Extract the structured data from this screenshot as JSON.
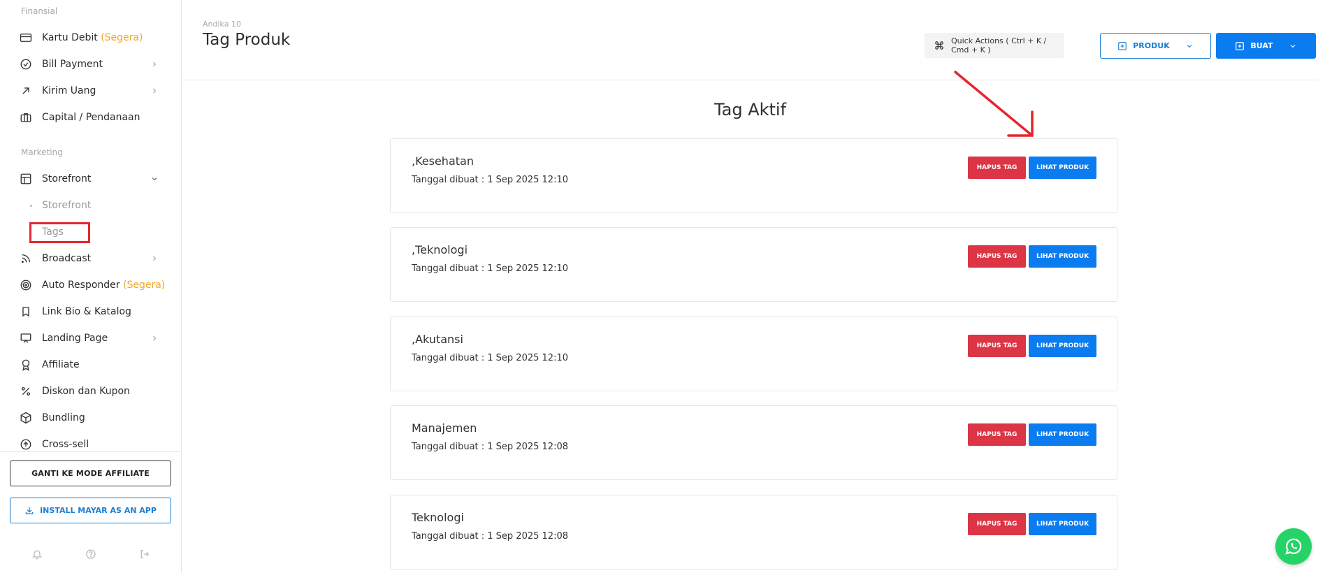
{
  "sidebar": {
    "section_finansial": "Finansial",
    "kartu_debit": "Kartu Debit ",
    "kartu_debit_soon": "(Segera)",
    "bill_payment": "Bill Payment",
    "kirim_uang": "Kirim Uang",
    "capital": "Capital / Pendanaan",
    "section_marketing": "Marketing",
    "storefront": "Storefront",
    "sub_storefront": "Storefront",
    "sub_tags": "Tags",
    "broadcast": "Broadcast",
    "auto_responder": "Auto Responder ",
    "auto_responder_soon": "(Segera)",
    "link_bio": "Link Bio & Katalog",
    "landing_page": "Landing Page",
    "affiliate": "Affiliate",
    "diskon": "Diskon dan Kupon",
    "bundling": "Bundling",
    "cross_sell": "Cross-sell",
    "btn_affiliate_mode": "GANTI KE MODE AFFILIATE",
    "btn_install": "INSTALL MAYAR AS AN APP"
  },
  "header": {
    "breadcrumb": "Andika 10",
    "title": "Tag Produk",
    "quick_actions": "Quick Actions ( Ctrl + K / Cmd + K )",
    "btn_produk": "PRODUK",
    "btn_buat": "BUAT"
  },
  "main": {
    "title": "Tag Aktif",
    "btn_hapus": "HAPUS TAG",
    "btn_lihat": "LIHAT PRODUK",
    "tags": [
      {
        "name": ",Kesehatan",
        "date": "Tanggal dibuat : 1 Sep 2025 12:10"
      },
      {
        "name": ",Teknologi",
        "date": "Tanggal dibuat : 1 Sep 2025 12:10"
      },
      {
        "name": ",Akutansi",
        "date": "Tanggal dibuat : 1 Sep 2025 12:10"
      },
      {
        "name": "Manajemen",
        "date": "Tanggal dibuat : 1 Sep 2025 12:08"
      },
      {
        "name": "Teknologi",
        "date": "Tanggal dibuat : 1 Sep 2025 12:08"
      }
    ]
  },
  "colors": {
    "primary": "#0a7cf0",
    "danger": "#dc3545",
    "soon": "#f5a623",
    "annotation": "#e5262d",
    "whatsapp": "#25d366"
  },
  "icons": [
    "credit-card-icon",
    "check-circle-icon",
    "arrow-up-right-icon",
    "briefcase-icon",
    "layout-icon",
    "rss-icon",
    "target-icon",
    "bookmark-icon",
    "monitor-icon",
    "award-icon",
    "percent-icon",
    "box-icon",
    "arrow-up-circle-icon",
    "download-icon",
    "bell-icon",
    "help-icon",
    "logout-icon",
    "command-icon",
    "plus-square-icon",
    "chevron-down-icon",
    "whatsapp-icon"
  ]
}
